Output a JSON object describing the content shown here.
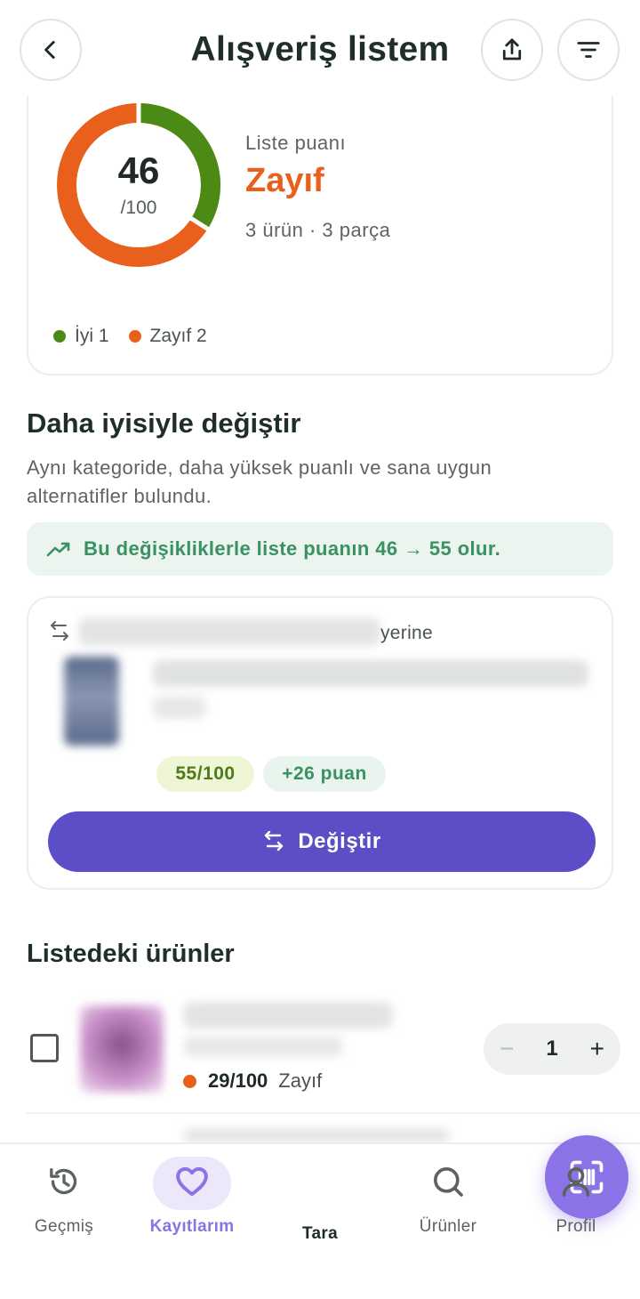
{
  "header": {
    "title": "Alışveriş listem",
    "back_icon": "chevron-left-icon",
    "share_icon": "share-icon",
    "filter_icon": "filter-icon"
  },
  "score": {
    "value": "46",
    "denominator": "/100",
    "label": "Liste puanı",
    "grade": "Zayıf",
    "meta": "3 ürün · 3 parça",
    "percent": 0.46,
    "good_color": "#4b8a14",
    "poor_color": "#e8601c",
    "legend": [
      {
        "label": "İyi 1",
        "color": "#4b8a14"
      },
      {
        "label": "Zayıf 2",
        "color": "#e8601c"
      }
    ]
  },
  "replace_section": {
    "title": "Daha iyisiyle değiştir",
    "description": "Aynı kategoride, daha yüksek puanlı ve sana uygun alternatifler bulundu.",
    "banner": "Bu değişikliklerle liste puanın 46 → 55 olur.",
    "card": {
      "instead_label": "yerine",
      "score_pill": "55/100",
      "gain_pill": "+26 puan",
      "button_label": "Değiştir"
    }
  },
  "list_section": {
    "title": "Listedeki ürünler",
    "items": [
      {
        "score": "29/100",
        "grade": "Zayıf",
        "quantity": "1",
        "minus": "−",
        "plus": "+"
      }
    ]
  },
  "tabbar": {
    "tabs": [
      {
        "label": "Geçmiş",
        "icon": "history-icon"
      },
      {
        "label": "Kayıtlarım",
        "icon": "heart-icon",
        "active": true
      },
      {
        "label": "Tara",
        "icon": "scan-icon"
      },
      {
        "label": "Ürünler",
        "icon": "search-icon"
      },
      {
        "label": "Profil",
        "icon": "user-icon"
      }
    ],
    "accent": "#8b72e6"
  }
}
